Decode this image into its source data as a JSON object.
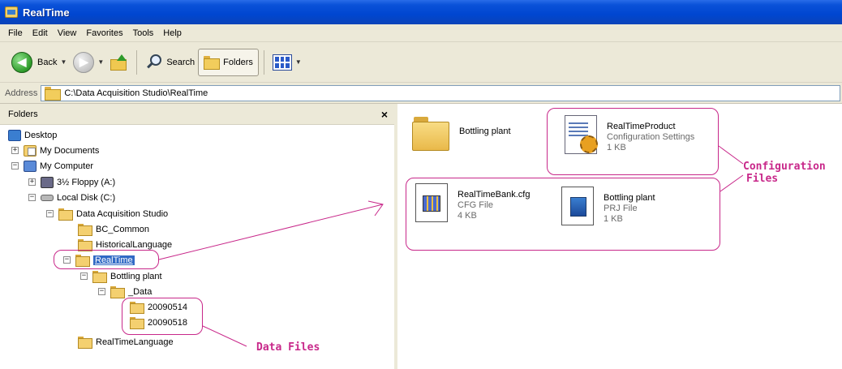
{
  "window": {
    "title": "RealTime"
  },
  "menu": [
    "File",
    "Edit",
    "View",
    "Favorites",
    "Tools",
    "Help"
  ],
  "toolbar": {
    "back_label": "Back",
    "search_label": "Search",
    "folders_label": "Folders"
  },
  "address": {
    "label": "Address",
    "value": "C:\\Data Acquisition Studio\\RealTime"
  },
  "folders_pane": {
    "title": "Folders",
    "close_glyph": "×",
    "tree": {
      "desktop": "Desktop",
      "my_documents": "My Documents",
      "my_computer": "My Computer",
      "floppy": "3½ Floppy (A:)",
      "local_disk": "Local Disk (C:)",
      "das": "Data Acquisition Studio",
      "bc_common": "BC_Common",
      "historical": "HistoricalLanguage",
      "realtime": "RealTime",
      "bottling": "Bottling plant",
      "data": "_Data",
      "d1": "20090514",
      "d2": "20090518",
      "rtlang": "RealTimeLanguage"
    }
  },
  "content": {
    "items": [
      {
        "name": "Bottling plant",
        "type": "",
        "size": ""
      },
      {
        "name": "RealTimeProduct",
        "type": "Configuration Settings",
        "size": "1 KB"
      },
      {
        "name": "RealTimeBank.cfg",
        "type": "CFG File",
        "size": "4 KB"
      },
      {
        "name": "Bottling plant",
        "type": "PRJ File",
        "size": "1 KB"
      }
    ]
  },
  "annotations": {
    "config_line1": "Configuration",
    "config_line2": "Files",
    "data_files": "Data Files",
    "color": "#c8288a"
  }
}
